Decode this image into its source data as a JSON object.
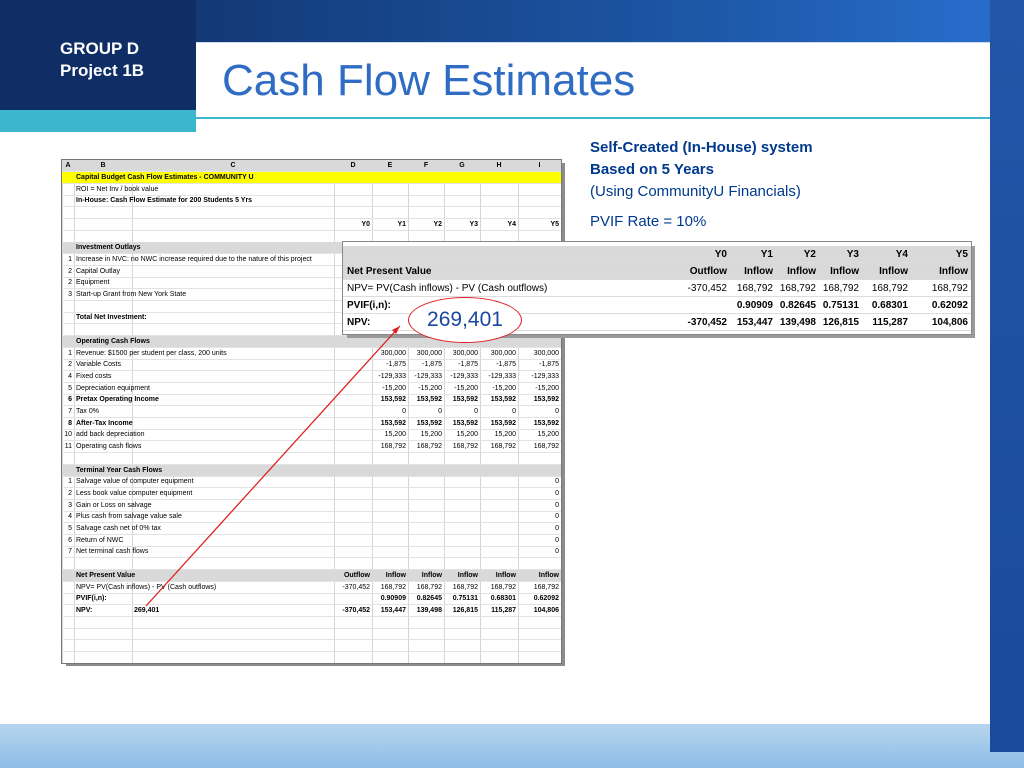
{
  "group_label": [
    "GROUP D",
    "Project 1B"
  ],
  "title": "Cash Flow Estimates",
  "info": {
    "line1": "Self-Created (In-House) system",
    "line2": "Based on 5 Years",
    "line3": "(Using CommunityU Financials)",
    "line4": "PVIF Rate = 10%"
  },
  "npv_callout": "269,401",
  "sheet": {
    "columns": [
      "A",
      "B",
      "C",
      "D",
      "E",
      "F",
      "G",
      "H",
      "I"
    ],
    "rows": [
      {
        "style": "yellow",
        "cells": {
          "b": "Capital Budget Cash Flow Estimates - COMMUNITY U"
        }
      },
      {
        "cells": {
          "b": "ROI = Net Inv / book value"
        }
      },
      {
        "style": "bold",
        "cells": {
          "b": "In-House: Cash Flow Estimate for 200 Students 5 Yrs"
        }
      },
      {
        "cells": {}
      },
      {
        "style": "bold",
        "cells": {
          "d": "Y0",
          "e": "Y1",
          "f": "Y2",
          "g": "Y3",
          "h": "Y4",
          "i": "Y5"
        }
      },
      {
        "cells": {}
      },
      {
        "style": "hdr",
        "cells": {
          "b": "Investment Outlays"
        }
      },
      {
        "cells": {
          "a": "1",
          "b": "Increase in NVC: no NWC increase required due to the nature of this project"
        }
      },
      {
        "cells": {
          "a": "2",
          "b": "Capital Outlay"
        }
      },
      {
        "cells": {
          "a": "2",
          "b": "Equipment"
        }
      },
      {
        "cells": {
          "a": "3",
          "b": "Start-up Grant from New York State"
        }
      },
      {
        "cells": {}
      },
      {
        "style": "bold",
        "cells": {
          "b": "     Total Net Investment:"
        }
      },
      {
        "cells": {}
      },
      {
        "style": "hdr",
        "cells": {
          "b": "Operating Cash Flows"
        }
      },
      {
        "cells": {
          "a": "1",
          "b": "Revenue:  $1500 per student per class, 200 units",
          "e": "300,000",
          "f": "300,000",
          "g": "300,000",
          "h": "300,000",
          "i": "300,000"
        }
      },
      {
        "cells": {
          "a": "2",
          "b": "Variable Costs",
          "e": "-1,875",
          "f": "-1,875",
          "g": "-1,875",
          "h": "-1,875",
          "i": "-1,875"
        }
      },
      {
        "cells": {
          "a": "4",
          "b": "Fixed costs",
          "e": "-129,333",
          "f": "-129,333",
          "g": "-129,333",
          "h": "-129,333",
          "i": "-129,333"
        }
      },
      {
        "cells": {
          "a": "5",
          "b": "Depreciation equipment",
          "e": "-15,200",
          "f": "-15,200",
          "g": "-15,200",
          "h": "-15,200",
          "i": "-15,200"
        }
      },
      {
        "style": "bold",
        "cells": {
          "a": "6",
          "b": "Pretax Operating Income",
          "e": "153,592",
          "f": "153,592",
          "g": "153,592",
          "h": "153,592",
          "i": "153,592"
        }
      },
      {
        "cells": {
          "a": "7",
          "b": "Tax 0%",
          "e": "0",
          "f": "0",
          "g": "0",
          "h": "0",
          "i": "0"
        }
      },
      {
        "style": "bold",
        "cells": {
          "a": "8",
          "b": "After-Tax Income",
          "e": "153,592",
          "f": "153,592",
          "g": "153,592",
          "h": "153,592",
          "i": "153,592"
        }
      },
      {
        "cells": {
          "a": "10",
          "b": "add back depreciation",
          "e": "15,200",
          "f": "15,200",
          "g": "15,200",
          "h": "15,200",
          "i": "15,200"
        }
      },
      {
        "cells": {
          "a": "11",
          "b": "Operating cash flows",
          "e": "168,792",
          "f": "168,792",
          "g": "168,792",
          "h": "168,792",
          "i": "168,792"
        }
      },
      {
        "cells": {}
      },
      {
        "style": "hdr",
        "cells": {
          "b": "Terminal Year Cash Flows"
        }
      },
      {
        "cells": {
          "a": "1",
          "b": "Salvage value of computer equipment",
          "i": "0"
        }
      },
      {
        "cells": {
          "a": "2",
          "b": "Less book value computer equipment",
          "i": "0"
        }
      },
      {
        "cells": {
          "a": "3",
          "b": "Gain or Loss on salvage",
          "i": "0"
        }
      },
      {
        "cells": {
          "a": "4",
          "b": "Plus cash from salvage value sale",
          "i": "0"
        }
      },
      {
        "cells": {
          "a": "5",
          "b": "Salvage cash net of 0% tax",
          "i": "0"
        }
      },
      {
        "cells": {
          "a": "6",
          "b": "Return of NWC",
          "i": "0"
        }
      },
      {
        "cells": {
          "a": "7",
          "b": "Net terminal cash flows",
          "i": "0"
        }
      },
      {
        "cells": {}
      },
      {
        "style": "hdr",
        "cells": {
          "b": "Net Present Value",
          "d": "Outflow",
          "e": "Inflow",
          "f": "Inflow",
          "g": "Inflow",
          "h": "Inflow",
          "i": "Inflow"
        }
      },
      {
        "cells": {
          "b": "NPV= PV(Cash inflows) - PV (Cash outflows)",
          "d": "-370,452",
          "e": "168,792",
          "f": "168,792",
          "g": "168,792",
          "h": "168,792",
          "i": "168,792"
        }
      },
      {
        "style": "bold",
        "cells": {
          "b": "PVIF(i,n):",
          "e": "0.90909",
          "f": "0.82645",
          "g": "0.75131",
          "h": "0.68301",
          "i": "0.62092"
        }
      },
      {
        "style": "bold",
        "cells": {
          "b": "NPV:",
          "c": "269,401",
          "d": "-370,452",
          "e": "153,447",
          "f": "139,498",
          "g": "126,815",
          "h": "115,287",
          "i": "104,806"
        }
      }
    ]
  },
  "callout_table": {
    "years": [
      "Y0",
      "Y1",
      "Y2",
      "Y3",
      "Y4",
      "Y5"
    ],
    "header_label": "Net Present Value",
    "flow_types": [
      "Outflow",
      "Inflow",
      "Inflow",
      "Inflow",
      "Inflow",
      "Inflow"
    ],
    "formula_label": "NPV= PV(Cash inflows) - PV (Cash outflows)",
    "cash_flows": [
      "-370,452",
      "168,792",
      "168,792",
      "168,792",
      "168,792",
      "168,792"
    ],
    "pvif_label": "PVIF(i,n):",
    "pvif": [
      "",
      "0.90909",
      "0.82645",
      "0.75131",
      "0.68301",
      "0.62092"
    ],
    "npv_label": "NPV:",
    "npv_values": [
      "-370,452",
      "153,447",
      "139,498",
      "126,815",
      "115,287",
      "104,806"
    ]
  }
}
